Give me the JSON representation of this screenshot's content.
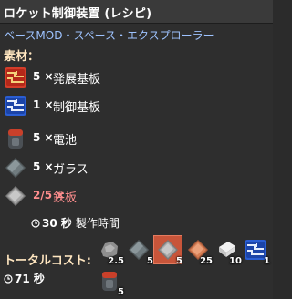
{
  "window": {
    "title": "ロケット制御装置 (レシピ)",
    "category": "ベースMOD・スペース・エクスプローラー"
  },
  "ingredients_label": "素材：",
  "ingredients": [
    {
      "icon": "advanced-circuit-icon",
      "count": "5 ×",
      "name": "発展基板",
      "warn": false
    },
    {
      "icon": "processing-unit-icon",
      "count": "1 ×",
      "name": "制御基板",
      "warn": false
    },
    {
      "icon": "battery-icon",
      "count": "5 ×",
      "name": "電池",
      "warn": false
    },
    {
      "icon": "glass-icon",
      "count": "5 ×",
      "name": "ガラス",
      "warn": false
    },
    {
      "icon": "iron-plate-icon",
      "count": "2/5 ×",
      "name": "鉄板",
      "warn": true
    }
  ],
  "craft_time": {
    "value": "30 秒",
    "label": "製作時間"
  },
  "total_cost": {
    "label": "トータルコスト:",
    "time": "71 秒",
    "items": [
      {
        "icon": "stone-icon",
        "amount": "2.5"
      },
      {
        "icon": "glass-icon",
        "amount": "5"
      },
      {
        "icon": "iron-plate-icon",
        "amount": "5",
        "selected": true
      },
      {
        "icon": "copper-plate-icon",
        "amount": "25"
      },
      {
        "icon": "plastic-icon",
        "amount": "10"
      },
      {
        "icon": "processing-unit-icon",
        "amount": "1"
      },
      {
        "icon": "battery-icon",
        "amount": "5"
      }
    ]
  },
  "colors": {
    "section_label": "#ffe6c0",
    "category_link": "#9ec3ff",
    "warning": "#ff8e8e",
    "selected_slot": "#c8553a"
  }
}
